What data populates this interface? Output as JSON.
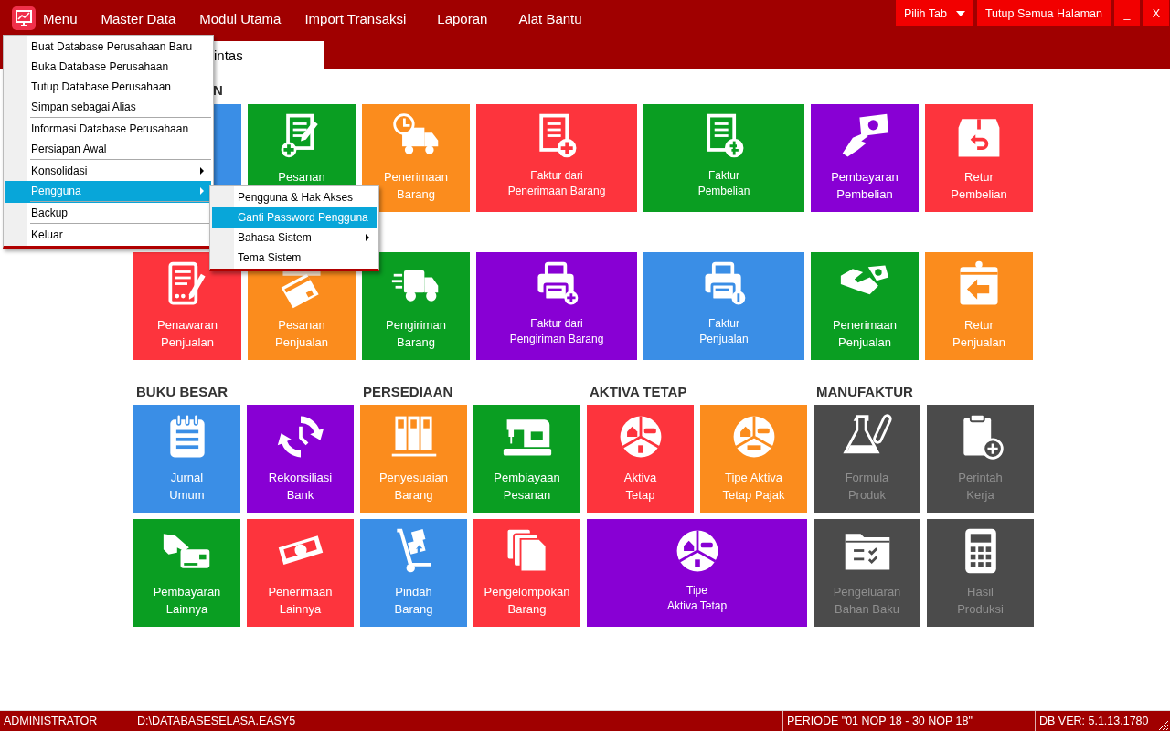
{
  "menubar": {
    "items": [
      {
        "label": "Menu"
      },
      {
        "label": "Master Data"
      },
      {
        "label": "Modul Utama"
      },
      {
        "label": "Import Transaksi"
      },
      {
        "label": "Laporan"
      },
      {
        "label": "Alat Bantu"
      }
    ]
  },
  "window_buttons": [
    {
      "label": "Pilih Tab",
      "dropdown": true
    },
    {
      "label": "Tutup Semua Halaman",
      "dropdown": false
    },
    {
      "label": "_",
      "dropdown": false
    },
    {
      "label": "X",
      "dropdown": false
    }
  ],
  "tabs": [
    {
      "label": "intas",
      "selected": true
    }
  ],
  "dashboard": {
    "top_sections": [
      {
        "heading": "N",
        "tiles": [
          {
            "color": "#3a8ee6",
            "wide": false
          },
          {
            "lines": [
              "Pesanan"
            ],
            "color": "#0a9e22",
            "wide": false,
            "disabled": false
          },
          {
            "lines": [
              "Penerimaan",
              "Barang"
            ],
            "color": "#fb8c1d",
            "wide": false,
            "disabled": false
          },
          {
            "lines": [
              "Faktur dari",
              "Penerimaan Barang"
            ],
            "color": "#fd343d",
            "wide": true,
            "disabled": false
          },
          {
            "lines": [
              "Faktur",
              "Pembelian"
            ],
            "color": "#0a9e22",
            "wide": true,
            "disabled": false
          },
          {
            "lines": [
              "Pembayaran",
              "Pembelian"
            ],
            "color": "#8800d4",
            "wide": false,
            "disabled": false
          },
          {
            "lines": [
              "Retur",
              "Pembelian"
            ],
            "color": "#fd343d",
            "wide": false,
            "disabled": false
          }
        ]
      },
      {
        "tiles": [
          {
            "lines": [
              "Penawaran",
              "Penjualan"
            ],
            "color": "#fd343d",
            "wide": false,
            "disabled": false
          },
          {
            "lines": [
              "Pesanan",
              "Penjualan"
            ],
            "color": "#fb8c1d",
            "wide": false,
            "disabled": false
          },
          {
            "lines": [
              "Pengiriman",
              "Barang"
            ],
            "color": "#0a9e22",
            "wide": false,
            "disabled": false
          },
          {
            "lines": [
              "Faktur dari",
              "Pengiriman Barang"
            ],
            "color": "#8800d4",
            "wide": true,
            "disabled": false
          },
          {
            "lines": [
              "Faktur",
              "Penjualan"
            ],
            "color": "#3a8ee6",
            "wide": true,
            "disabled": false
          },
          {
            "lines": [
              "Penerimaan",
              "Penjualan"
            ],
            "color": "#0a9e22",
            "wide": false,
            "disabled": false
          },
          {
            "lines": [
              "Retur",
              "Penjualan"
            ],
            "color": "#fb8c1d",
            "wide": false,
            "disabled": false
          }
        ]
      }
    ],
    "sections": [
      {
        "heading": "BUKU BESAR",
        "tiles": [
          {
            "lines": [
              "Jurnal",
              "Umum"
            ],
            "color": "#3a8ee6",
            "wide": false,
            "disabled": false
          },
          {
            "lines": [
              "Rekonsiliasi",
              "Bank"
            ],
            "color": "#8800d4",
            "wide": false,
            "disabled": false
          },
          {
            "lines": [
              "Pembayaran",
              "Lainnya"
            ],
            "color": "#0a9e22",
            "wide": false,
            "disabled": false
          },
          {
            "lines": [
              "Penerimaan",
              "Lainnya"
            ],
            "color": "#fd343d",
            "wide": false,
            "disabled": false
          }
        ]
      },
      {
        "heading": "PERSEDIAAN",
        "tiles": [
          {
            "lines": [
              "Penyesuaian",
              "Barang"
            ],
            "color": "#fb8c1d",
            "wide": false,
            "disabled": false
          },
          {
            "lines": [
              "Pembiayaan",
              "Pesanan"
            ],
            "color": "#0a9e22",
            "wide": false,
            "disabled": false
          },
          {
            "lines": [
              "Pindah",
              "Barang"
            ],
            "color": "#3a8ee6",
            "wide": false,
            "disabled": false
          },
          {
            "lines": [
              "Pengelompokan",
              "Barang"
            ],
            "color": "#fd343d",
            "wide": false,
            "disabled": false
          }
        ]
      },
      {
        "heading": "AKTIVA TETAP",
        "tiles": [
          {
            "lines": [
              "Aktiva",
              "Tetap"
            ],
            "color": "#fd343d",
            "wide": false,
            "disabled": false
          },
          {
            "lines": [
              "Tipe Aktiva",
              "Tetap Pajak"
            ],
            "color": "#fb8c1d",
            "wide": false,
            "disabled": false
          },
          {
            "lines": [
              "Tipe",
              "Aktiva Tetap"
            ],
            "color": "#8800d4",
            "wide": true,
            "disabled": false
          }
        ]
      },
      {
        "heading": "MANUFAKTUR",
        "tiles": [
          {
            "lines": [
              "Formula",
              "Produk"
            ],
            "color": "#4b4b4b",
            "wide": false,
            "disabled": true
          },
          {
            "lines": [
              "Perintah",
              "Kerja"
            ],
            "color": "#4b4b4b",
            "wide": false,
            "disabled": true
          },
          {
            "lines": [
              "Pengeluaran",
              "Bahan Baku"
            ],
            "color": "#4b4b4b",
            "wide": false,
            "disabled": true
          },
          {
            "lines": [
              "Hasil",
              "Produksi"
            ],
            "color": "#4b4b4b",
            "wide": false,
            "disabled": true
          }
        ]
      }
    ]
  },
  "open_menu": {
    "items": [
      {
        "label": "Buat Database Perusahaan Baru",
        "selected": false,
        "submenu": false,
        "divider_after": false
      },
      {
        "label": "Buka Database Perusahaan",
        "selected": false,
        "submenu": false,
        "divider_after": false
      },
      {
        "label": "Tutup Database Perusahaan",
        "selected": false,
        "submenu": false,
        "divider_after": false
      },
      {
        "label": "Simpan sebagai Alias",
        "selected": false,
        "submenu": false,
        "divider_after": true
      },
      {
        "label": "Informasi Database Perusahaan",
        "selected": false,
        "submenu": false,
        "divider_after": false
      },
      {
        "label": "Persiapan Awal",
        "selected": false,
        "submenu": false,
        "divider_after": true
      },
      {
        "label": "Konsolidasi",
        "selected": false,
        "submenu": true,
        "divider_after": false
      },
      {
        "label": "Pengguna",
        "selected": true,
        "submenu": true,
        "divider_after": true
      },
      {
        "label": "Backup",
        "selected": false,
        "submenu": false,
        "divider_after": true
      },
      {
        "label": "Keluar",
        "selected": false,
        "submenu": false,
        "divider_after": false
      }
    ]
  },
  "submenu": {
    "items": [
      {
        "label": "Pengguna & Hak Akses",
        "selected": false,
        "submenu": false,
        "divider_after": false
      },
      {
        "label": "Ganti Password Pengguna",
        "selected": true,
        "submenu": false,
        "divider_after": false
      },
      {
        "label": "Bahasa Sistem",
        "selected": false,
        "submenu": true,
        "divider_after": false
      },
      {
        "label": "Tema Sistem",
        "selected": false,
        "submenu": false,
        "divider_after": false
      }
    ]
  },
  "status_bar": [
    "ADMINISTRATOR",
    "D:\\DATABASESELASA.EASY5",
    "PERIODE \"01 NOP 18 - 30 NOP 18\"",
    "DB VER: 5.1.13.1780"
  ]
}
